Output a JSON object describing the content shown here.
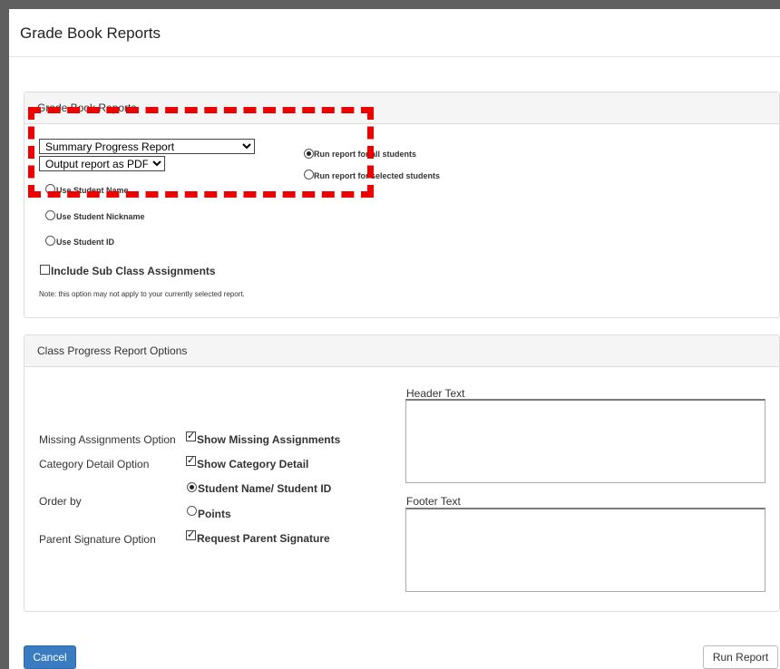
{
  "page": {
    "title": "Grade Book Reports"
  },
  "report_panel": {
    "heading": "Grade Book Reports",
    "report_select": {
      "value": "Summary Progress Report",
      "options": [
        "Summary Progress Report"
      ]
    },
    "output_select": {
      "value": "Output report as PDF",
      "options": [
        "Output report as PDF"
      ]
    },
    "run_scope": [
      {
        "label": "Run report for all students",
        "selected": true
      },
      {
        "label": "Run report for selected students",
        "selected": false
      }
    ],
    "name_options": [
      {
        "label": "Use Student Name",
        "selected": false
      },
      {
        "label": "Use Student Nickname",
        "selected": false
      },
      {
        "label": "Use Student ID",
        "selected": false
      }
    ],
    "include_sub_class": {
      "label": "Include Sub Class Assignments",
      "checked": false
    },
    "note": "Note: this option may not apply to your currently selected report."
  },
  "options_panel": {
    "heading": "Class Progress Report Options",
    "missing": {
      "label": "Missing Assignments Option",
      "checkbox_label": "Show Missing Assignments",
      "checked": true
    },
    "category": {
      "label": "Category Detail Option",
      "checkbox_label": "Show Category Detail",
      "checked": true
    },
    "order_by": {
      "label": "Order by",
      "options": [
        {
          "label": "Student Name/ Student ID",
          "selected": true
        },
        {
          "label": "Points",
          "selected": false
        }
      ]
    },
    "parent_signature": {
      "label": "Parent Signature Option",
      "checkbox_label": "Request Parent Signature",
      "checked": true
    },
    "header_text": {
      "label": "Header Text",
      "value": ""
    },
    "footer_text": {
      "label": "Footer Text",
      "value": ""
    }
  },
  "buttons": {
    "cancel": "Cancel",
    "run": "Run Report"
  },
  "colors": {
    "annotation": "#ee0000",
    "primary_button": "#3a7cc2"
  }
}
